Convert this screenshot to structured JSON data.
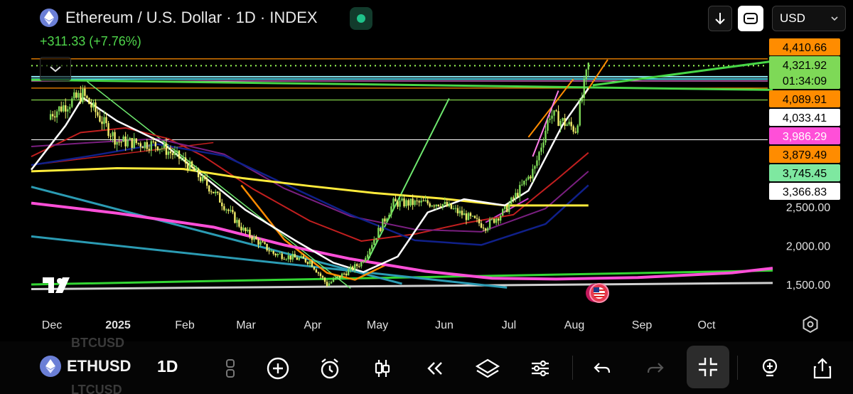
{
  "header": {
    "title": "Ethereum / U.S. Dollar · 1D · INDEX",
    "change": "+311.33 (+7.76%)",
    "currency": "USD"
  },
  "bottom_bar": {
    "ghost_symbol_top": "BTCUSD",
    "symbol": "ETHUSD",
    "ghost_symbol_bottom": "LTCUSD",
    "interval": "1D"
  },
  "colors": {
    "background": "#000000",
    "candle_up": "#7ed957",
    "candle_down": "#f2ee6b",
    "ma_white": "#ffffff",
    "ma_red": "#c21f1f",
    "ma_purple": "#7a1f80",
    "ma_blue": "#10208a",
    "ma_yellow": "#ffeb3b",
    "ma_magenta": "#ff4fd8",
    "trend_green": "#33d633",
    "trend_teal": "#2b9bb3",
    "trend_orange": "#ff8c00",
    "hline_orange": "#ff8c00",
    "hline_cyan": "#4fd8ee",
    "hline_green_dotted": "#9cff57"
  },
  "chart_data": {
    "type": "candlestick",
    "title": "Ethereum / U.S. Dollar · 1D · INDEX",
    "x_ticks": [
      "Dec",
      "2025",
      "Feb",
      "Mar",
      "Apr",
      "May",
      "Jun",
      "Jul",
      "Aug",
      "Sep",
      "Oct"
    ],
    "y_ticks": [
      2500,
      2000,
      1500
    ],
    "y_tick_labels": [
      "2,500.00",
      "2,000.00",
      "1,500.00"
    ],
    "ylim": [
      1370,
      4720
    ],
    "price_labels": [
      {
        "value": 4410.66,
        "text": "4,410.66",
        "color": "#ff8c00"
      },
      {
        "value": 4321.92,
        "text": "4,321.92",
        "sub": "01:34:09",
        "color": "#7ed957"
      },
      {
        "value": 4089.91,
        "text": "4,089.91",
        "color": "#ff8c00"
      },
      {
        "value": 4033.41,
        "text": "4,033.41",
        "color": "#ffffff"
      },
      {
        "value": 3986.29,
        "text": "3,986.29",
        "color": "#ff4fd8"
      },
      {
        "value": 3879.49,
        "text": "3,879.49",
        "color": "#ff8c00"
      },
      {
        "value": 3745.45,
        "text": "3,745.45",
        "color": "#7ee8a0"
      },
      {
        "value": 3366.83,
        "text": "3,366.83",
        "color": "#ffffff"
      }
    ],
    "approx_closes": [
      {
        "date": "2024-12-01",
        "close": 3700
      },
      {
        "date": "2024-12-16",
        "close": 3950
      },
      {
        "date": "2025-01-01",
        "close": 3350
      },
      {
        "date": "2025-01-20",
        "close": 3300
      },
      {
        "date": "2025-02-01",
        "close": 3100
      },
      {
        "date": "2025-02-15",
        "close": 2700
      },
      {
        "date": "2025-03-01",
        "close": 2200
      },
      {
        "date": "2025-03-15",
        "close": 1900
      },
      {
        "date": "2025-04-01",
        "close": 1800
      },
      {
        "date": "2025-04-09",
        "close": 1500
      },
      {
        "date": "2025-04-25",
        "close": 1780
      },
      {
        "date": "2025-05-10",
        "close": 2550
      },
      {
        "date": "2025-06-01",
        "close": 2550
      },
      {
        "date": "2025-06-22",
        "close": 2250
      },
      {
        "date": "2025-07-01",
        "close": 2450
      },
      {
        "date": "2025-07-15",
        "close": 3000
      },
      {
        "date": "2025-07-22",
        "close": 3700
      },
      {
        "date": "2025-08-03",
        "close": 3500
      },
      {
        "date": "2025-08-09",
        "close": 4321.92
      }
    ]
  }
}
